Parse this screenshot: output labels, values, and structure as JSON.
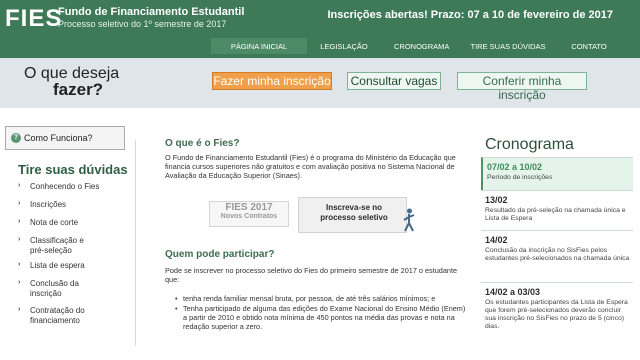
{
  "header": {
    "logo": "FIES",
    "title": "Fundo de Financiamento Estudantil",
    "subtitle": "Processo seletivo do 1º semestre de 2017",
    "banner": "Inscrições abertas! Prazo: 07 a 10 de fevereiro de 2017"
  },
  "nav": [
    "Página inicial",
    "Legislação",
    "Cronograma",
    "Tire suas dúvidas",
    "Contato"
  ],
  "hero": {
    "q1": "O que deseja",
    "q2": "fazer?",
    "btn1": "Fazer minha inscrição",
    "btn2": "Consultar vagas",
    "btn3": "Conferir minha inscrição"
  },
  "sidebar": {
    "how": "Como Funciona?",
    "title": "Tire suas dúvidas",
    "items": [
      "Conhecendo o Fies",
      "Inscrições",
      "Nota de corte",
      "Classificação e pré-seleção",
      "Lista de espera",
      "Conclusão da inscrição",
      "Contratação do financiamento"
    ]
  },
  "main": {
    "sec1": "O que é o Fies?",
    "p1": "O Fundo de Financiamento Estudantil (Fies) é o programa do Ministério da Educação que financia cursos superiores não gratuitos e com avaliação positiva no Sistema Nacional de Avaliação da Educação Superior (Sinaes).",
    "boxa1": "FIES 2017",
    "boxa2": "Novos Contratos",
    "boxb": "Inscreva-se no processo seletivo",
    "sec2": "Quem pode participar?",
    "p2": "Pode se inscrever no processo seletivo do Fies do primeiro semestre de 2017 o estudante que:",
    "bullets": [
      "tenha renda familiar mensal bruta, por pessoa, de até três salários mínimos; e",
      "Tenha participado de alguma das edições do Exame Nacional do Ensino Médio (Enem) a partir de 2010 e obtido nota mínima de 450 pontos na média das provas e nota na redação superior a zero."
    ]
  },
  "cronograma": {
    "title": "Cronograma",
    "items": [
      {
        "date": "07/02 a 10/02",
        "text": "Período de inscrições"
      },
      {
        "date": "13/02",
        "text": "Resultado da pré-seleção na chamada única e Lista de Espera"
      },
      {
        "date": "14/02",
        "text": "Conclusão da inscrição no SisFies pelos estudantes pré-selecionados na chamada única"
      },
      {
        "date": "14/02 a 03/03",
        "text": "Os estudantes participantes da Lista de Espera que forem pré-selecionados deverão concluir sua inscrição no SisFies no prazo de 5 (cinco) dias."
      }
    ]
  }
}
